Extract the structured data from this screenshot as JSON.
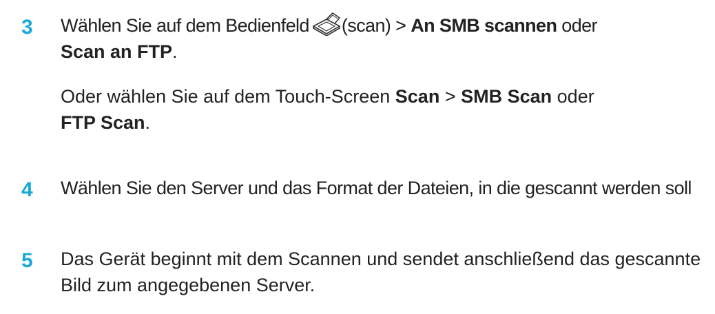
{
  "steps": [
    {
      "number": "3",
      "line1_pre": "Wählen Sie auf dem Bedienfeld",
      "icon": "scanner-icon",
      "line1_after_icon": "(scan) > ",
      "bold1": "An SMB scannen",
      "mid1": " oder ",
      "bold2": "Scan an FTP",
      "end1": ".",
      "sub_pre": "Oder wählen Sie auf dem Touch-Screen ",
      "sub_bold1": "Scan",
      "sub_mid1": " > ",
      "sub_bold2": "SMB Scan",
      "sub_mid2": " oder",
      "sub_bold3": "FTP Scan",
      "sub_end": "."
    },
    {
      "number": "4",
      "text": "Wählen Sie den Server und das Format der Dateien, in die gescannt werden soll"
    },
    {
      "number": "5",
      "text": "Das Gerät beginnt mit dem Scannen und sendet anschließend das gescannte Bild zum angegebenen Server."
    }
  ],
  "colors": {
    "step_number": "#1ba9d8",
    "text": "#222222"
  }
}
